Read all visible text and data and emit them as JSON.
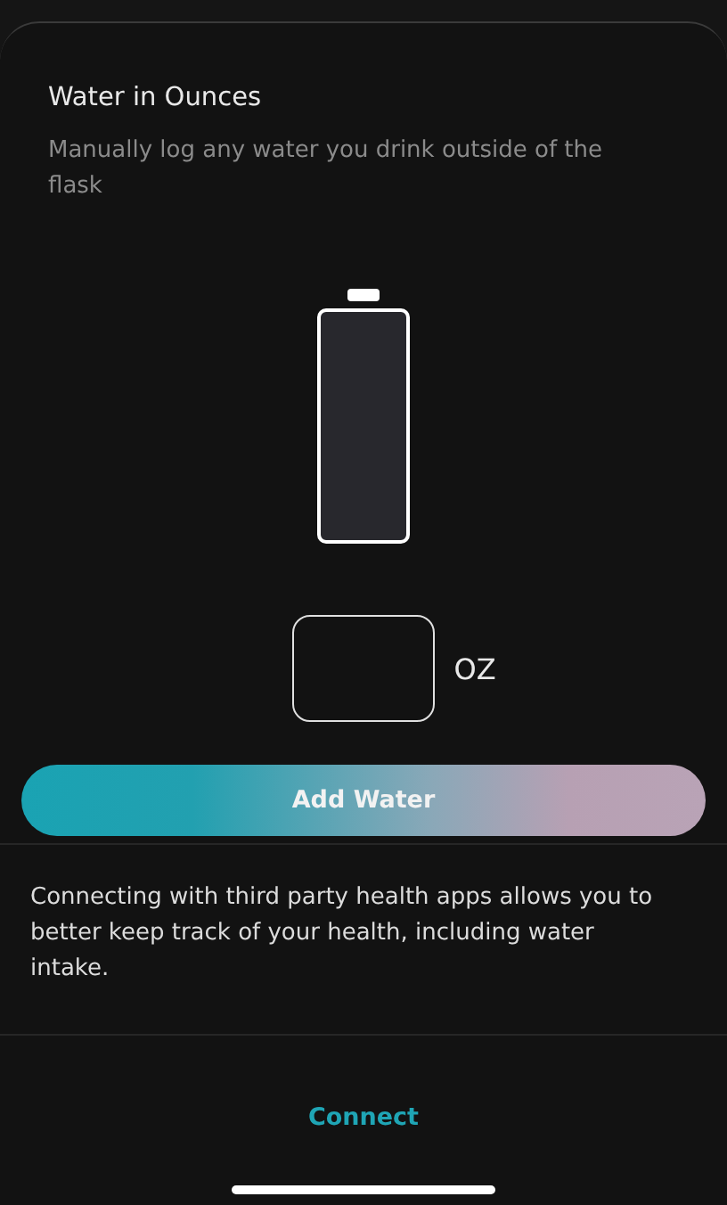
{
  "sheet": {
    "title": "Water in Ounces",
    "subtitle": "Manually log any water you drink outside of the flask"
  },
  "bottle": {
    "level": 0
  },
  "amount": {
    "unit": "OZ"
  },
  "add_button": "Add Water",
  "info_text": "Connecting with third party health apps allows you to better keep track of your health, including water intake.",
  "connect_button": "Connect"
}
